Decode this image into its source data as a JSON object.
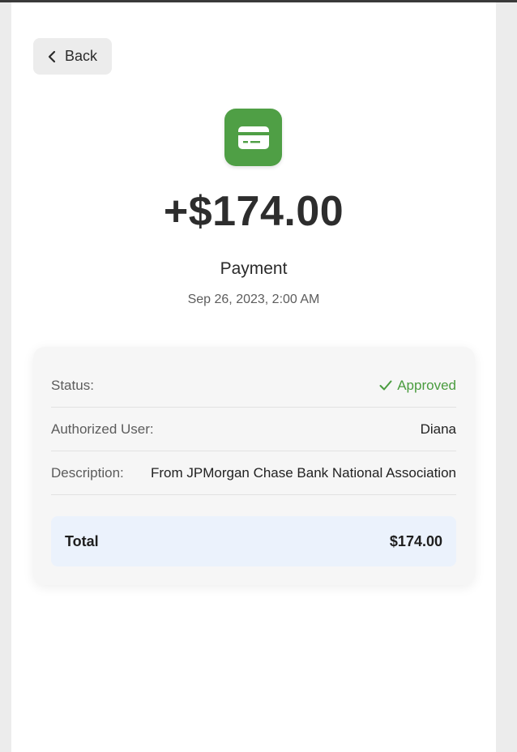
{
  "header": {
    "back_label": "Back"
  },
  "transaction": {
    "icon": "credit-card-icon",
    "amount": "+$174.00",
    "type": "Payment",
    "datetime": "Sep 26, 2023, 2:00 AM"
  },
  "details": {
    "status_label": "Status:",
    "status_value": "Approved",
    "authorized_user_label": "Authorized User:",
    "authorized_user_value": "Diana",
    "description_label": "Description:",
    "description_value": "From JPMorgan Chase Bank National Association"
  },
  "total": {
    "label": "Total",
    "value": "$174.00"
  },
  "colors": {
    "accent_green": "#4f9f45",
    "status_green": "#4a9c3f",
    "total_bg": "#ebf2fc"
  }
}
